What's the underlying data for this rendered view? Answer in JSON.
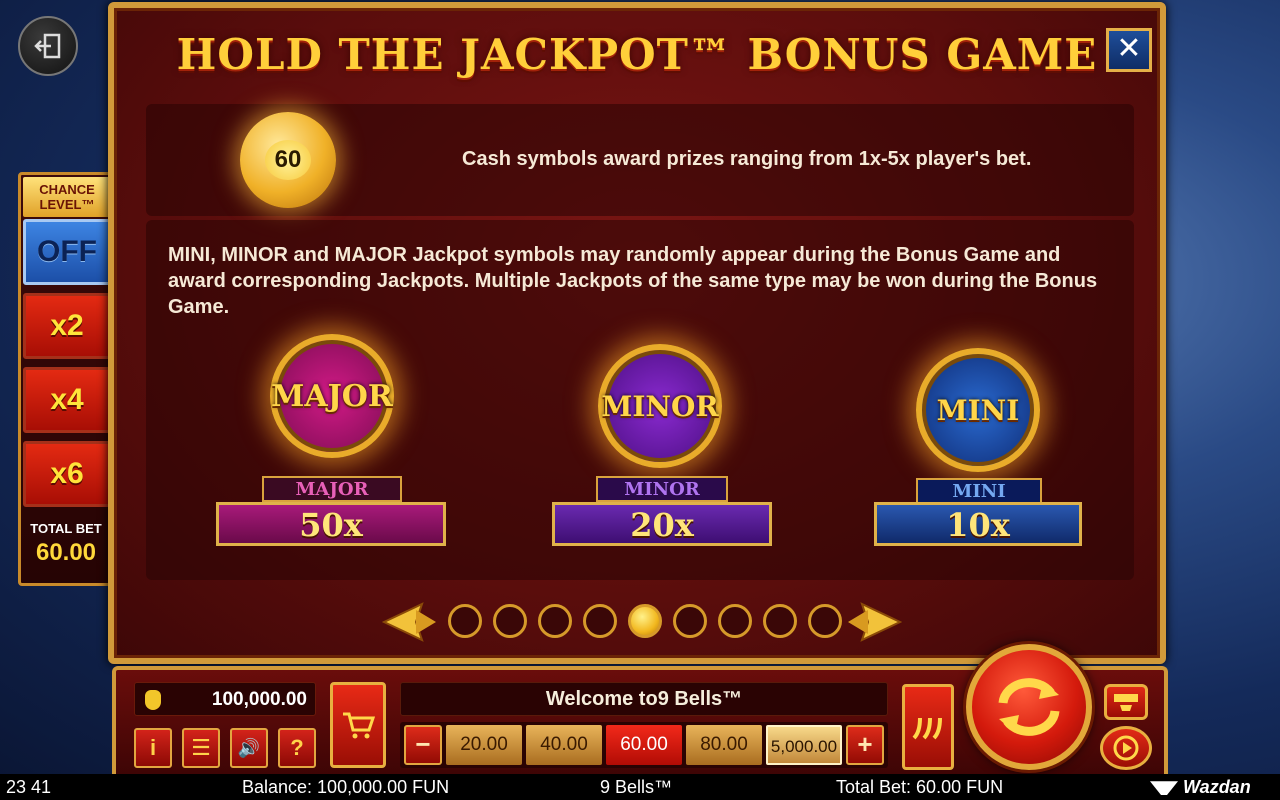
{
  "modal": {
    "title": "HOLD THE JACKPOT™ BONUS GAME",
    "close_label": "✕",
    "cash_coin_value": "60",
    "cash_text": "Cash symbols award prizes ranging from 1x-5x player's bet.",
    "jackpot_text": "MINI, MINOR and MAJOR Jackpot symbols may randomly appear during the Bonus Game and award corresponding Jackpots. Multiple Jackpots of the same type may be won during the Bonus Game.",
    "jackpots": [
      {
        "token_text": "MAJOR",
        "label": "MAJOR",
        "multiplier": "50x",
        "color": "#a3136a"
      },
      {
        "token_text": "MINOR",
        "label": "MINOR",
        "multiplier": "20x",
        "color": "#6a1fa8"
      },
      {
        "token_text": "MINI",
        "label": "MINI",
        "multiplier": "10x",
        "color": "#1f4fa8"
      }
    ],
    "pager": {
      "total_pages": 9,
      "current_page": 5
    }
  },
  "chance_level": {
    "title": "CHANCE LEVEL™",
    "options": [
      "OFF",
      "x2",
      "x4",
      "x6"
    ],
    "selected": "OFF",
    "total_bet_label": "TOTAL BET",
    "total_bet_value": "60.00"
  },
  "controls": {
    "balance": "100,000.00",
    "welcome": "Welcome to9 Bells™",
    "bet_decrease": "−",
    "bet_increase": "+",
    "bet_options": [
      "20.00",
      "40.00",
      "60.00",
      "80.00",
      "5,000.00"
    ],
    "selected_bet": "60.00",
    "small_buttons": [
      {
        "name": "info-button",
        "icon": "info-icon",
        "label": "i"
      },
      {
        "name": "menu-button",
        "icon": "menu-icon",
        "label": "☰"
      },
      {
        "name": "sound-button",
        "icon": "speaker-icon",
        "label": "🔊"
      },
      {
        "name": "help-button",
        "icon": "help-icon",
        "label": "?"
      }
    ]
  },
  "statusbar": {
    "time": "23 41",
    "balance": "Balance: 100,000.00 FUN",
    "game_name": "9 Bells™",
    "total_bet": "Total Bet: 60.00 FUN",
    "brand": "Wazdan"
  },
  "colors": {
    "gold": "#d19a3a",
    "panel_red": "#5a0d0c",
    "off_blue": "#2c6ad0",
    "chance_red": "#c41a0c"
  }
}
